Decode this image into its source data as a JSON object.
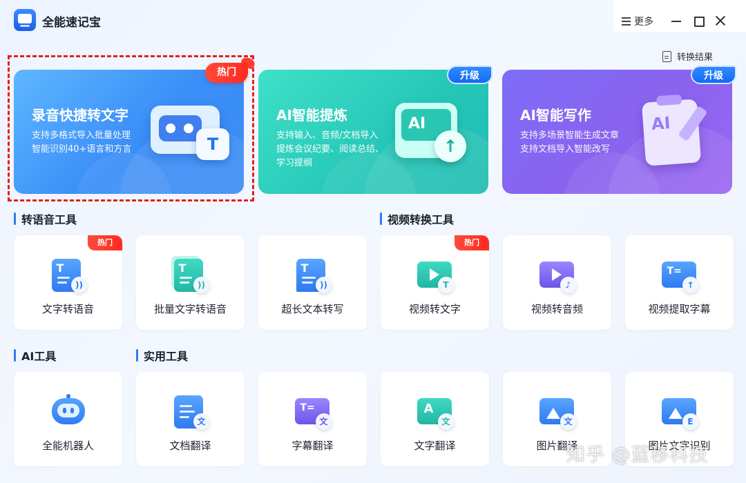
{
  "app": {
    "title": "全能速记宝"
  },
  "window": {
    "more_label": "更多"
  },
  "toolbar": {
    "convert_results_label": "转换结果"
  },
  "feature_cards": [
    {
      "title": "录音快捷转文字",
      "desc": [
        "支持多格式导入批量处理",
        "智能识别40+语言和方言"
      ],
      "badge": "热门",
      "highlighted": true,
      "icon": "cassette-tape-icon"
    },
    {
      "title": "AI智能提炼",
      "desc": [
        "支持输入、音频/文档导入",
        "提炼会议纪要、阅读总结、",
        "学习提纲"
      ],
      "badge": "升级",
      "icon": "ai-screen-upload-icon"
    },
    {
      "title": "AI智能写作",
      "desc": [
        "支持多场景智能生成文章",
        "支持文档导入智能改写"
      ],
      "badge": "升级",
      "icon": "ai-notepad-pencil-icon"
    }
  ],
  "sections": {
    "speech_tools": {
      "title": "转语音工具"
    },
    "video_tools": {
      "title": "视频转换工具"
    },
    "ai_tools": {
      "title": "AI工具"
    },
    "utility_tools": {
      "title": "实用工具"
    }
  },
  "tools_row1": [
    {
      "label": "文字转语音",
      "badge": "热门",
      "icon": "text-to-speech-icon"
    },
    {
      "label": "批量文字转语音",
      "badge": "",
      "icon": "batch-text-to-speech-icon"
    },
    {
      "label": "超长文本转写",
      "badge": "",
      "icon": "long-text-transcribe-icon"
    },
    {
      "label": "视频转文字",
      "badge": "热门",
      "icon": "video-to-text-icon"
    },
    {
      "label": "视频转音频",
      "badge": "",
      "icon": "video-to-audio-icon"
    },
    {
      "label": "视频提取字幕",
      "badge": "",
      "icon": "video-subtitle-extract-icon"
    }
  ],
  "tools_row2": [
    {
      "label": "全能机器人",
      "icon": "robot-icon"
    },
    {
      "label": "文档翻译",
      "icon": "document-translate-icon"
    },
    {
      "label": "字幕翻译",
      "icon": "subtitle-translate-icon"
    },
    {
      "label": "文字翻译",
      "icon": "text-translate-icon"
    },
    {
      "label": "图片翻译",
      "icon": "image-translate-icon"
    },
    {
      "label": "图片文字识别",
      "icon": "image-ocr-icon"
    }
  ],
  "watermark": "知乎 @蓝移科技",
  "colors": {
    "accent": "#2d7cf6",
    "card_blue": "#3a8ef7",
    "card_teal": "#27c8b8",
    "card_purple": "#8a63ee",
    "hot_badge": "#ff2a1f",
    "upgrade_badge": "#1469f5",
    "highlight_border": "#e02020"
  }
}
